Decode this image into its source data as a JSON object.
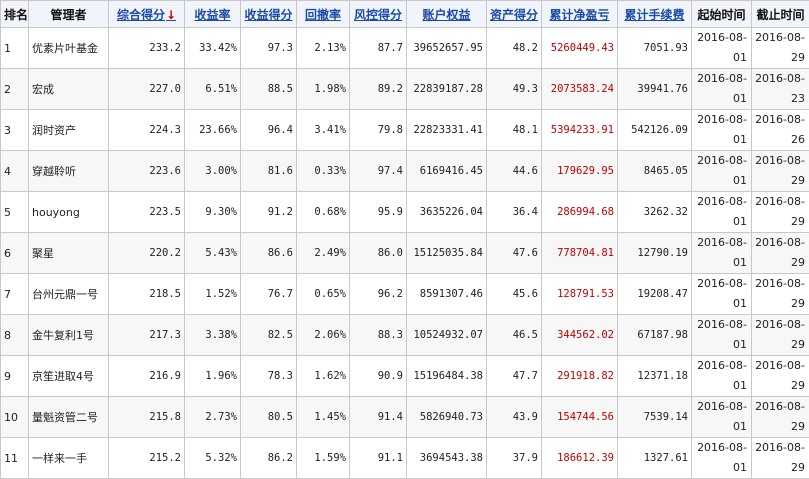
{
  "table": {
    "headers": {
      "rank": "排名",
      "manager": "管理者",
      "score": "综合得分",
      "score_arrow": "↓",
      "return_rate": "收益率",
      "return_score": "收益得分",
      "drawdown": "回撤率",
      "risk_score": "风控得分",
      "equity": "账户权益",
      "asset_score": "资产得分",
      "net_pnl": "累计净盈亏",
      "fees": "累计手续费",
      "start": "起始时间",
      "end": "截止时间"
    },
    "rows": [
      {
        "rank": "1",
        "manager": "优素片叶基金",
        "score": "233.2",
        "return_rate": "33.42%",
        "return_score": "97.3",
        "drawdown": "2.13%",
        "risk_score": "87.7",
        "equity": "39652657.95",
        "asset_score": "48.2",
        "net_pnl": "5260449.43",
        "fees": "7051.93",
        "start_y": "2016-08-",
        "start_d": "01",
        "end_y": "2016-08-",
        "end_d": "29"
      },
      {
        "rank": "2",
        "manager": "宏成",
        "score": "227.0",
        "return_rate": "6.51%",
        "return_score": "88.5",
        "drawdown": "1.98%",
        "risk_score": "89.2",
        "equity": "22839187.28",
        "asset_score": "49.3",
        "net_pnl": "2073583.24",
        "fees": "39941.76",
        "start_y": "2016-08-",
        "start_d": "01",
        "end_y": "2016-08-",
        "end_d": "23"
      },
      {
        "rank": "3",
        "manager": "润时资产",
        "score": "224.3",
        "return_rate": "23.66%",
        "return_score": "96.4",
        "drawdown": "3.41%",
        "risk_score": "79.8",
        "equity": "22823331.41",
        "asset_score": "48.1",
        "net_pnl": "5394233.91",
        "fees": "542126.09",
        "start_y": "2016-08-",
        "start_d": "01",
        "end_y": "2016-08-",
        "end_d": "26"
      },
      {
        "rank": "4",
        "manager": "穿越聆听",
        "score": "223.6",
        "return_rate": "3.00%",
        "return_score": "81.6",
        "drawdown": "0.33%",
        "risk_score": "97.4",
        "equity": "6169416.45",
        "asset_score": "44.6",
        "net_pnl": "179629.95",
        "fees": "8465.05",
        "start_y": "2016-08-",
        "start_d": "01",
        "end_y": "2016-08-",
        "end_d": "29"
      },
      {
        "rank": "5",
        "manager": "houyong",
        "score": "223.5",
        "return_rate": "9.30%",
        "return_score": "91.2",
        "drawdown": "0.68%",
        "risk_score": "95.9",
        "equity": "3635226.04",
        "asset_score": "36.4",
        "net_pnl": "286994.68",
        "fees": "3262.32",
        "start_y": "2016-08-",
        "start_d": "01",
        "end_y": "2016-08-",
        "end_d": "29"
      },
      {
        "rank": "6",
        "manager": "聚星",
        "score": "220.2",
        "return_rate": "5.43%",
        "return_score": "86.6",
        "drawdown": "2.49%",
        "risk_score": "86.0",
        "equity": "15125035.84",
        "asset_score": "47.6",
        "net_pnl": "778704.81",
        "fees": "12790.19",
        "start_y": "2016-08-",
        "start_d": "01",
        "end_y": "2016-08-",
        "end_d": "29"
      },
      {
        "rank": "7",
        "manager": "台州元鼎一号",
        "score": "218.5",
        "return_rate": "1.52%",
        "return_score": "76.7",
        "drawdown": "0.65%",
        "risk_score": "96.2",
        "equity": "8591307.46",
        "asset_score": "45.6",
        "net_pnl": "128791.53",
        "fees": "19208.47",
        "start_y": "2016-08-",
        "start_d": "01",
        "end_y": "2016-08-",
        "end_d": "29"
      },
      {
        "rank": "8",
        "manager": "金牛复利1号",
        "score": "217.3",
        "return_rate": "3.38%",
        "return_score": "82.5",
        "drawdown": "2.06%",
        "risk_score": "88.3",
        "equity": "10524932.07",
        "asset_score": "46.5",
        "net_pnl": "344562.02",
        "fees": "67187.98",
        "start_y": "2016-08-",
        "start_d": "01",
        "end_y": "2016-08-",
        "end_d": "29"
      },
      {
        "rank": "9",
        "manager": "京笙进取4号",
        "score": "216.9",
        "return_rate": "1.96%",
        "return_score": "78.3",
        "drawdown": "1.62%",
        "risk_score": "90.9",
        "equity": "15196484.38",
        "asset_score": "47.7",
        "net_pnl": "291918.82",
        "fees": "12371.18",
        "start_y": "2016-08-",
        "start_d": "01",
        "end_y": "2016-08-",
        "end_d": "29"
      },
      {
        "rank": "10",
        "manager": "量魁资管二号",
        "score": "215.8",
        "return_rate": "2.73%",
        "return_score": "80.5",
        "drawdown": "1.45%",
        "risk_score": "91.4",
        "equity": "5826940.73",
        "asset_score": "43.9",
        "net_pnl": "154744.56",
        "fees": "7539.14",
        "start_y": "2016-08-",
        "start_d": "01",
        "end_y": "2016-08-",
        "end_d": "29"
      },
      {
        "rank": "11",
        "manager": "一样来一手",
        "score": "215.2",
        "return_rate": "5.32%",
        "return_score": "86.2",
        "drawdown": "1.59%",
        "risk_score": "91.1",
        "equity": "3694543.38",
        "asset_score": "37.9",
        "net_pnl": "186612.39",
        "fees": "1327.61",
        "start_y": "2016-08-",
        "start_d": "01",
        "end_y": "2016-08-",
        "end_d": "29"
      }
    ]
  }
}
